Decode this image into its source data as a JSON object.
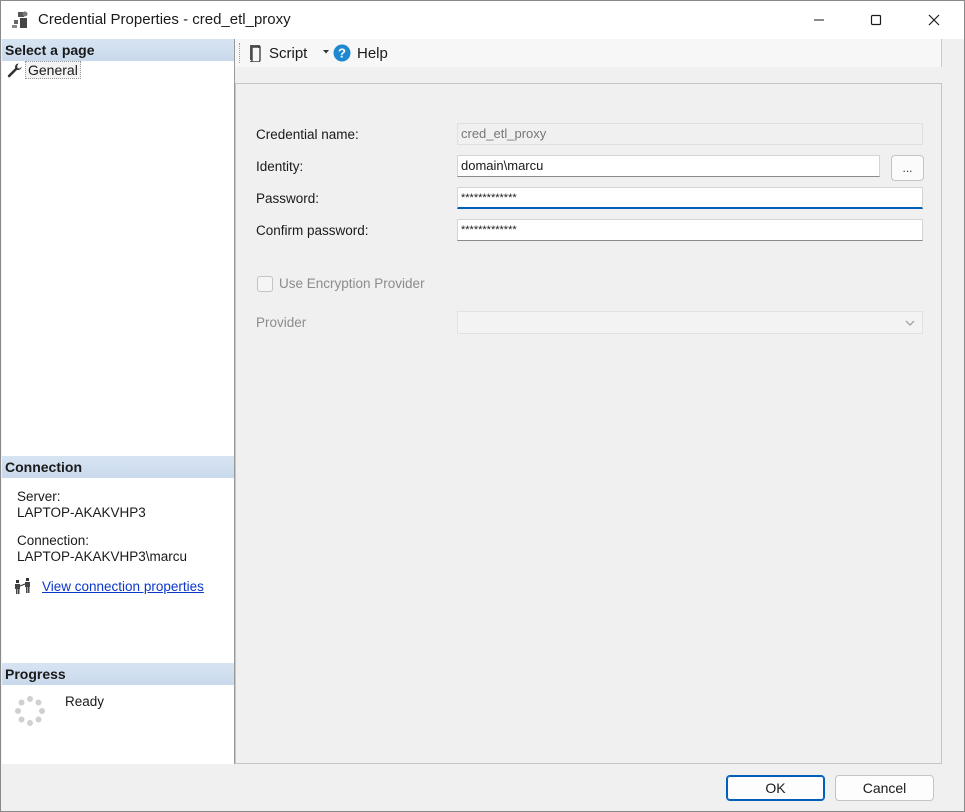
{
  "window": {
    "title": "Credential Properties - cred_etl_proxy"
  },
  "sidebar": {
    "select_page_header": "Select a page",
    "pages": [
      {
        "label": "General",
        "icon": "wrench-icon"
      }
    ],
    "connection_header": "Connection",
    "server_label": "Server:",
    "server_value": "LAPTOP-AKAKVHP3",
    "connection_label": "Connection:",
    "connection_value": "LAPTOP-AKAKVHP3\\marcu",
    "view_connection_link": "View connection properties",
    "progress_header": "Progress",
    "progress_status": "Ready"
  },
  "toolbar": {
    "script_label": "Script",
    "help_label": "Help"
  },
  "form": {
    "credential_name_label": "Credential name:",
    "credential_name_value": "cred_etl_proxy",
    "identity_label": "Identity:",
    "identity_value": "domain\\marcu",
    "browse_label": "...",
    "password_label": "Password:",
    "password_value": "*************",
    "confirm_password_label": "Confirm password:",
    "confirm_password_value": "*************",
    "use_encryption_label": "Use Encryption Provider",
    "use_encryption_checked": false,
    "provider_label": "Provider",
    "provider_value": ""
  },
  "buttons": {
    "ok_label": "OK",
    "cancel_label": "Cancel"
  },
  "colors": {
    "accent": "#005fb8",
    "link": "#0b36c9",
    "section_header": "#c9d9ec"
  }
}
